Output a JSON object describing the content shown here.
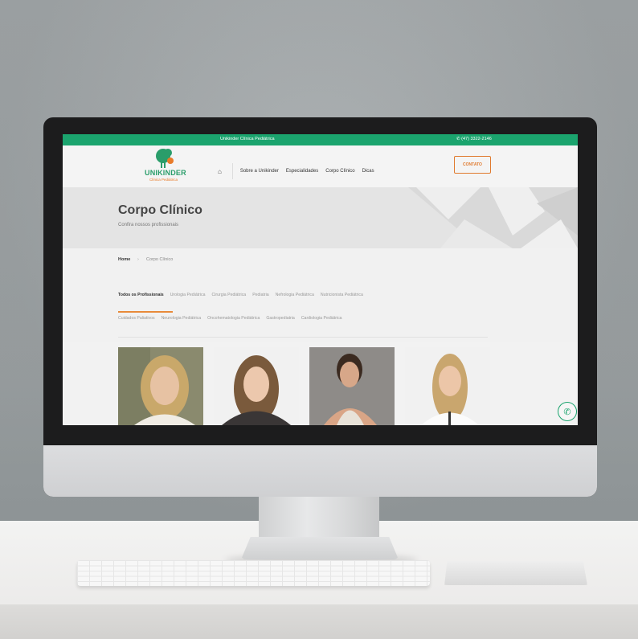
{
  "topbar": {
    "brand": "Unikinder Clínica Pediátrica",
    "phone": "(47) 3322-2146"
  },
  "logo": {
    "name": "UNIKINDER",
    "sub": "Clínica Pediátrica"
  },
  "nav": {
    "items": [
      "Sobre a Unikinder",
      "Especialidades",
      "Corpo Clínico",
      "Dicas"
    ]
  },
  "contact_label": "CONTATO",
  "hero": {
    "title": "Corpo Clínico",
    "subtitle": "Confira nossos profissionais"
  },
  "breadcrumb": {
    "home": "Home",
    "separator": "›",
    "current": "Corpo Clínico"
  },
  "filters": {
    "row1": [
      "Todos os Profissionais",
      "Urologia Pediátrica",
      "Cirurgia Pediátrica",
      "Pediatria",
      "Nefrologia Pediátrica",
      "Nutricionista Pediátrica"
    ],
    "row2": [
      "Cuidados Paliativos",
      "Neurologia Pediátrica",
      "Oncohematologia Pediátrica",
      "Gastropediatria",
      "Cardiologia Pediátrica"
    ],
    "active": "Todos os Profissionais"
  },
  "colors": {
    "brand_green": "#1ba46e",
    "accent_orange": "#e07a2e"
  },
  "icons": {
    "home": "home-icon",
    "phone": "phone-icon",
    "whatsapp": "whatsapp-icon"
  }
}
